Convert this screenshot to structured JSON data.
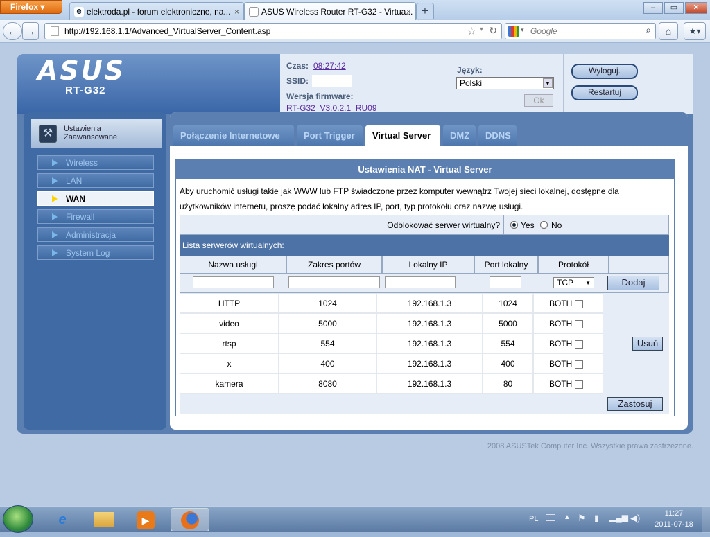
{
  "browser": {
    "menu_label": "Firefox",
    "tabs": [
      {
        "title": "elektroda.pl - forum elektroniczne, na...",
        "close": "×"
      },
      {
        "title": "ASUS Wireless Router RT-G32 - Virtua...",
        "close": "×"
      }
    ],
    "new_tab": "+",
    "url": "http://192.168.1.1/Advanced_VirtualServer_Content.asp",
    "search_placeholder": "Google",
    "window_controls": [
      "–",
      "▭",
      "✕"
    ]
  },
  "router": {
    "logo": "ASUS",
    "model": "RT-G32",
    "time_label": "Czas:",
    "time_value": "08:27:42",
    "ssid_label": "SSID:",
    "firmware_label": "Wersja firmware:",
    "firmware_value": "RT-G32_V3.0.2.1_RU09",
    "language_label": "Język:",
    "language_value": "Polski",
    "ok_label": "Ok",
    "logout_label": "Wyloguj.",
    "restart_label": "Restartuj"
  },
  "sidebar": {
    "header": "Ustawienia Zaawansowane",
    "items": [
      {
        "label": "Wireless",
        "selected": false
      },
      {
        "label": "LAN",
        "selected": false
      },
      {
        "label": "WAN",
        "selected": true
      },
      {
        "label": "Firewall",
        "selected": false
      },
      {
        "label": "Administracja",
        "selected": false
      },
      {
        "label": "System Log",
        "selected": false
      }
    ]
  },
  "page_tabs": [
    {
      "label": "Połączenie Internetowe",
      "active": false
    },
    {
      "label": "Port Trigger",
      "active": false
    },
    {
      "label": "Virtual Server",
      "active": true
    },
    {
      "label": "DMZ",
      "active": false
    },
    {
      "label": "DDNS",
      "active": false
    }
  ],
  "content": {
    "title": "Ustawienia NAT - Virtual Server",
    "description_line1": "Aby uruchomić usługi takie jak WWW lub FTP świadczone przez komputer wewnątrz Twojej sieci lokalnej, dostępne dla",
    "description_line2": "użytkowników internetu, proszę podać lokalny adres IP, port, typ protokołu oraz nazwę usługi.",
    "enable_question": "Odblokować serwer wirtualny?",
    "yes_label": "Yes",
    "no_label": "No",
    "enabled": true,
    "list_header": "Lista serwerów wirtualnych:",
    "columns": [
      "Nazwa usługi",
      "Zakres portów",
      "Lokalny IP",
      "Port lokalny",
      "Protokół"
    ],
    "new_protocol": "TCP",
    "add_label": "Dodaj",
    "remove_label": "Usuń",
    "apply_label": "Zastosuj",
    "rows": [
      {
        "name": "HTTP",
        "ports": "1024",
        "ip": "192.168.1.3",
        "local_port": "1024",
        "protocol": "BOTH"
      },
      {
        "name": "video",
        "ports": "5000",
        "ip": "192.168.1.3",
        "local_port": "5000",
        "protocol": "BOTH"
      },
      {
        "name": "rtsp",
        "ports": "554",
        "ip": "192.168.1.3",
        "local_port": "554",
        "protocol": "BOTH"
      },
      {
        "name": "x",
        "ports": "400",
        "ip": "192.168.1.3",
        "local_port": "400",
        "protocol": "BOTH"
      },
      {
        "name": "kamera",
        "ports": "8080",
        "ip": "192.168.1.3",
        "local_port": "80",
        "protocol": "BOTH"
      }
    ]
  },
  "footer": "2008 ASUSTek Computer Inc. Wszystkie prawa zastrzeżone.",
  "taskbar": {
    "apps": [
      "internet-explorer-icon",
      "folder-icon",
      "media-player-icon",
      "firefox-icon"
    ],
    "language": "PL",
    "time": "11:27",
    "date": "2011-07-18"
  }
}
